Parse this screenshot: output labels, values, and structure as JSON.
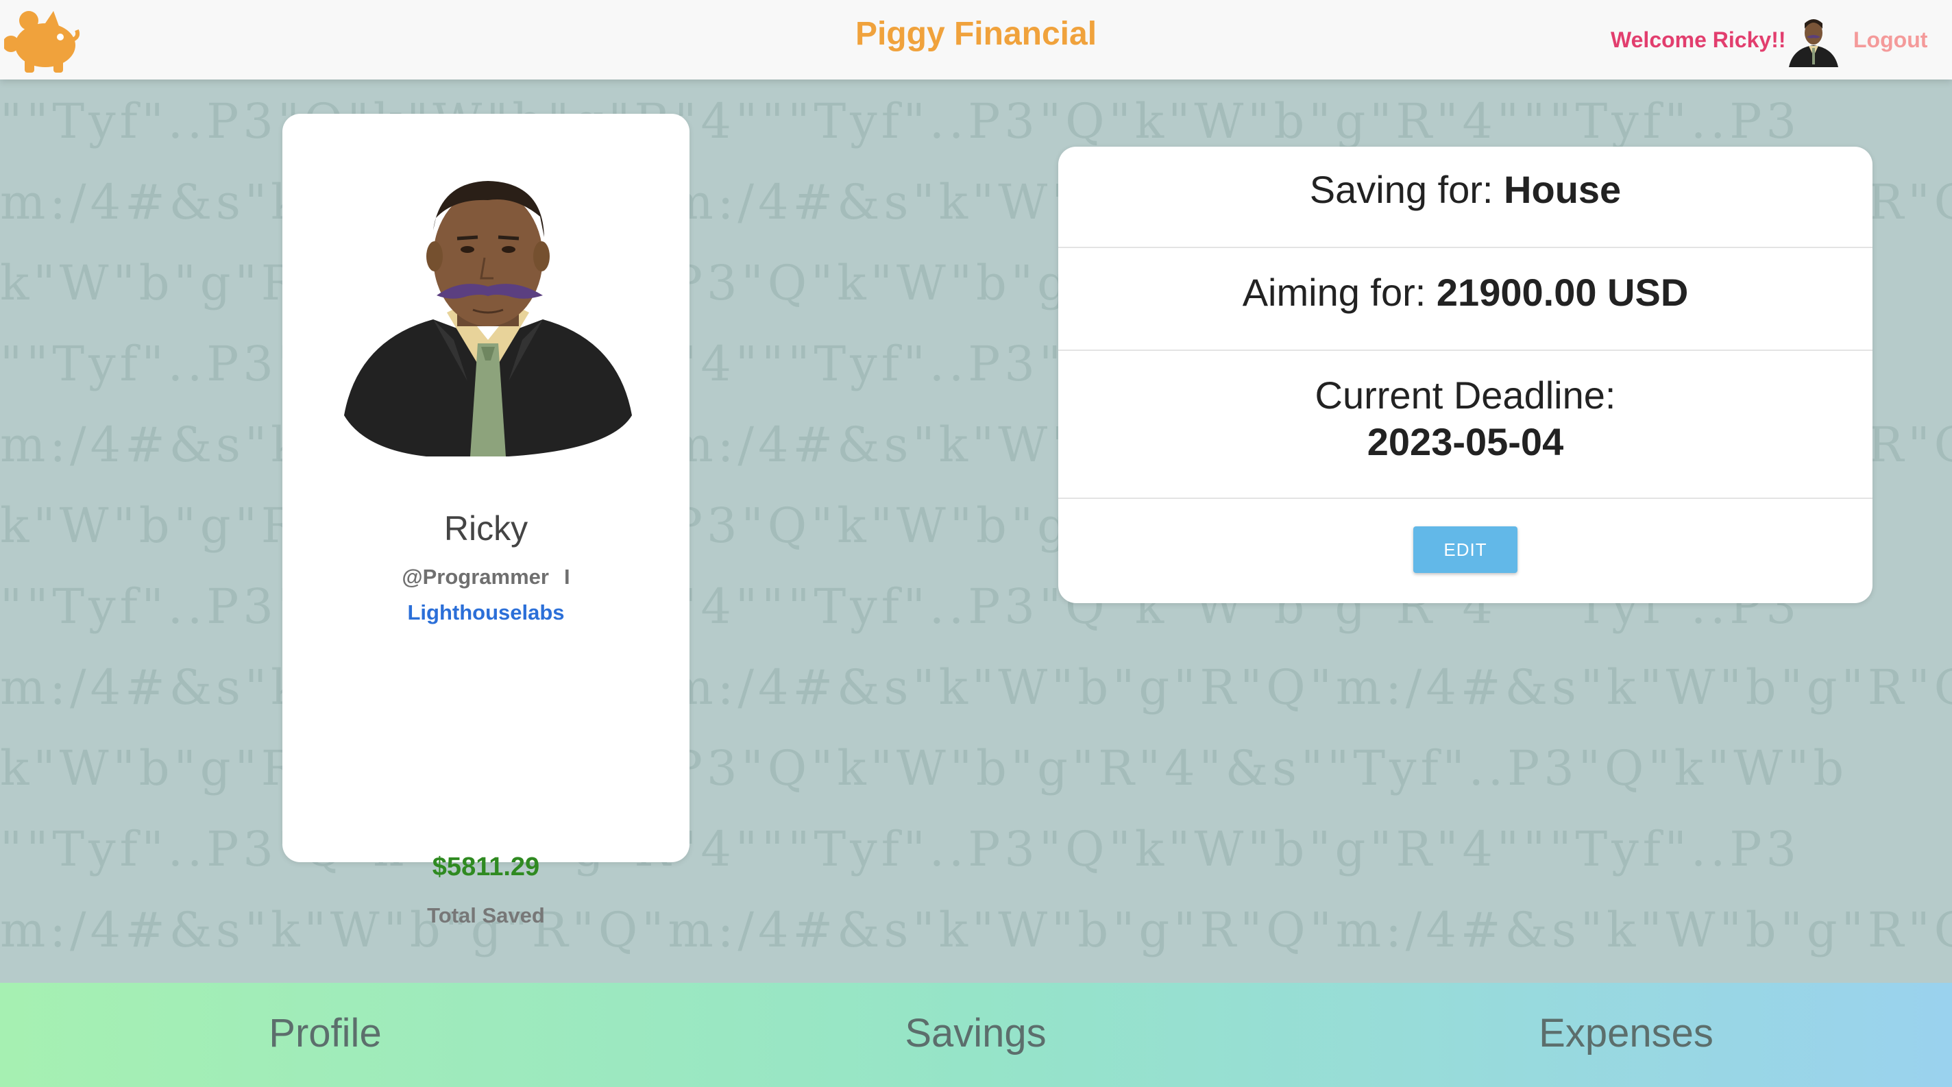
{
  "header": {
    "brand": "Piggy Financial",
    "welcome": "Welcome Ricky!!",
    "logout": "Logout",
    "logo_icon": "piggy-bank-icon",
    "brand_color": "#f0a23c"
  },
  "profile": {
    "name": "Ricky",
    "handle": "@Programmer",
    "separator": "I",
    "company": "Lighthouselabs",
    "total_saved": "$5811.29",
    "total_saved_label": "Total Saved"
  },
  "goal": {
    "saving_label": "Saving for:",
    "saving_value": "House",
    "aiming_label": "Aiming for:",
    "aiming_value": "21900.00 USD",
    "deadline_label": "Current Deadline:",
    "deadline_value": "2023-05-04",
    "edit_label": "EDIT"
  },
  "bottom_nav": {
    "tabs": [
      {
        "label": "Profile"
      },
      {
        "label": "Savings"
      },
      {
        "label": "Expenses"
      }
    ]
  }
}
